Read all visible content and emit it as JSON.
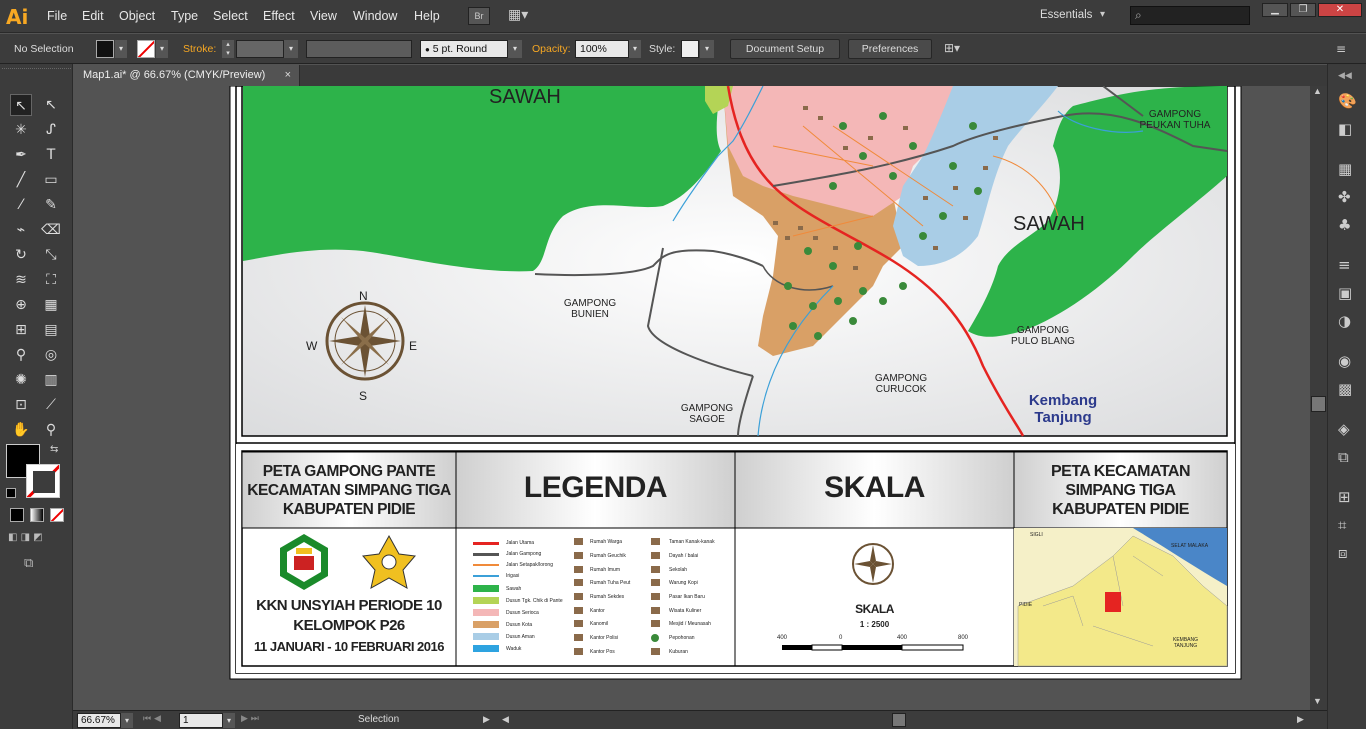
{
  "app": {
    "logo": "Ai",
    "workspace": "Essentials",
    "search_placeholder": ""
  },
  "menu": [
    "File",
    "Edit",
    "Object",
    "Type",
    "Select",
    "Effect",
    "View",
    "Window",
    "Help"
  ],
  "menu_extra": {
    "bridge": "Br"
  },
  "control_bar": {
    "selection": "No Selection",
    "stroke_label": "Stroke:",
    "brush": "5 pt. Round",
    "opacity_label": "Opacity:",
    "opacity": "100%",
    "style_label": "Style:",
    "document_setup": "Document Setup",
    "preferences": "Preferences"
  },
  "document_tab": {
    "title": "Map1.ai* @ 66.67% (CMYK/Preview)",
    "close": "×"
  },
  "status_bar": {
    "zoom": "66.67%",
    "artboard": "1",
    "status": "Selection"
  },
  "map": {
    "labels": {
      "sawah_left": "SAWAH",
      "sawah_right": "SAWAH",
      "peukan_tuha": [
        "GAMPONG",
        "PEUKAN TUHA"
      ],
      "bunien": [
        "GAMPONG",
        "BUNIEN"
      ],
      "pulo_blang": [
        "GAMPONG",
        "PULO BLANG"
      ],
      "curucok": [
        "GAMPONG",
        "CURUCOK"
      ],
      "sagoe": [
        "GAMPONG",
        "SAGOE"
      ],
      "kembang": [
        "Kembang",
        "Tanjung"
      ]
    },
    "compass": {
      "n": "N",
      "s": "S",
      "e": "E",
      "w": "W"
    }
  },
  "footer": {
    "title_box": [
      "PETA GAMPONG PANTE",
      "KECAMATAN SIMPANG TIGA",
      "KABUPATEN PIDIE"
    ],
    "legend_title": "LEGENDA",
    "scale_title": "SKALA",
    "kecamatan_title": [
      "PETA KECAMATAN",
      "SIMPANG TIGA",
      "KABUPATEN PIDIE"
    ],
    "kkn": [
      "KKN UNSYIAH PERIODE 10",
      "KELOMPOK P26",
      "11 JANUARI - 10 FEBRUARI 2016"
    ],
    "scale": {
      "label": "SKALA",
      "ratio": "1 : 2500",
      "ticks": [
        "400",
        "0",
        "400",
        "800"
      ]
    },
    "inset_labels": {
      "sigli": "SIGLI",
      "selat": "SELAT MALAKA",
      "pidie": "PIDIE",
      "kembang": [
        "KEMBANG",
        "TANJUNG"
      ]
    },
    "legend_col1": [
      {
        "label": "Jalan Utama",
        "color": "#e52421"
      },
      {
        "label": "Jalan Gampong",
        "color": "#555555"
      },
      {
        "label": "Jalan Setapak/lorong",
        "color": "#f08a3a"
      },
      {
        "label": "Irigasi",
        "color": "#3ba0d8"
      },
      {
        "label": "Sawah",
        "color": "#2db34a"
      },
      {
        "label": "Dusun Tgk. Chik di Pante",
        "color": "#b4d456"
      },
      {
        "label": "Dusun Serioca",
        "color": "#f4b7b7"
      },
      {
        "label": "Dusun Kota",
        "color": "#d9a066"
      },
      {
        "label": "Dusun Aman",
        "color": "#a9cde6"
      },
      {
        "label": "Waduk",
        "color": "#2ea3e0"
      }
    ],
    "legend_col2": [
      "Rumah Warga",
      "Rumah Geuchik",
      "Rumah Imum",
      "Rumah Tuha Peut",
      "Rumah Sekdes",
      "Kantor",
      "Kanomil",
      "Kantor Polisi",
      "Kantor Pos"
    ],
    "legend_col3": [
      "Taman Kanak-kanak",
      "Dayah / balai",
      "Sekolah",
      "Warung Kopi",
      "Pasar Ikan Baru",
      "Wisata Kuliner",
      "Mesjid / Meunasah",
      "Pepohonan",
      "Kuburan"
    ]
  }
}
